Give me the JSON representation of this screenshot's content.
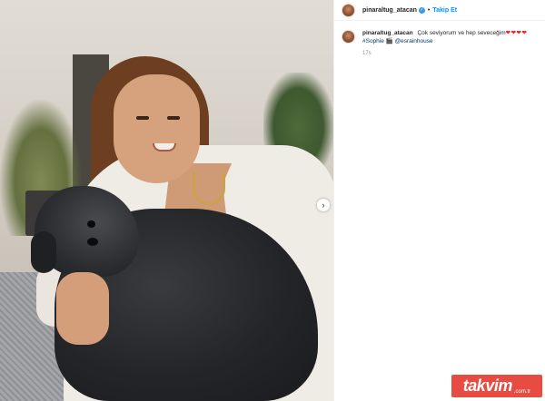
{
  "post": {
    "author": {
      "username": "pinaraltug_atacan",
      "verified": true,
      "follow_label": "Takip Et",
      "separator": "•"
    },
    "caption": {
      "username": "pinaraltug_atacan",
      "text": "Çok seviyorum ve hep seveceğim",
      "hearts": "❤❤❤❤",
      "hashtag": "#Sophie",
      "emoji": "🎬",
      "mention": "@esrainhouse"
    },
    "timestamp": "17s",
    "media": {
      "next_icon": "chevron-right-icon",
      "next_glyph": "›"
    }
  },
  "watermark": {
    "brand": "takvim",
    "tld": ".com.tr",
    "color": "#e53c31"
  },
  "colors": {
    "link": "#00376b",
    "follow": "#0095f6",
    "verified": "#3897f0",
    "heart": "#e0242a"
  }
}
